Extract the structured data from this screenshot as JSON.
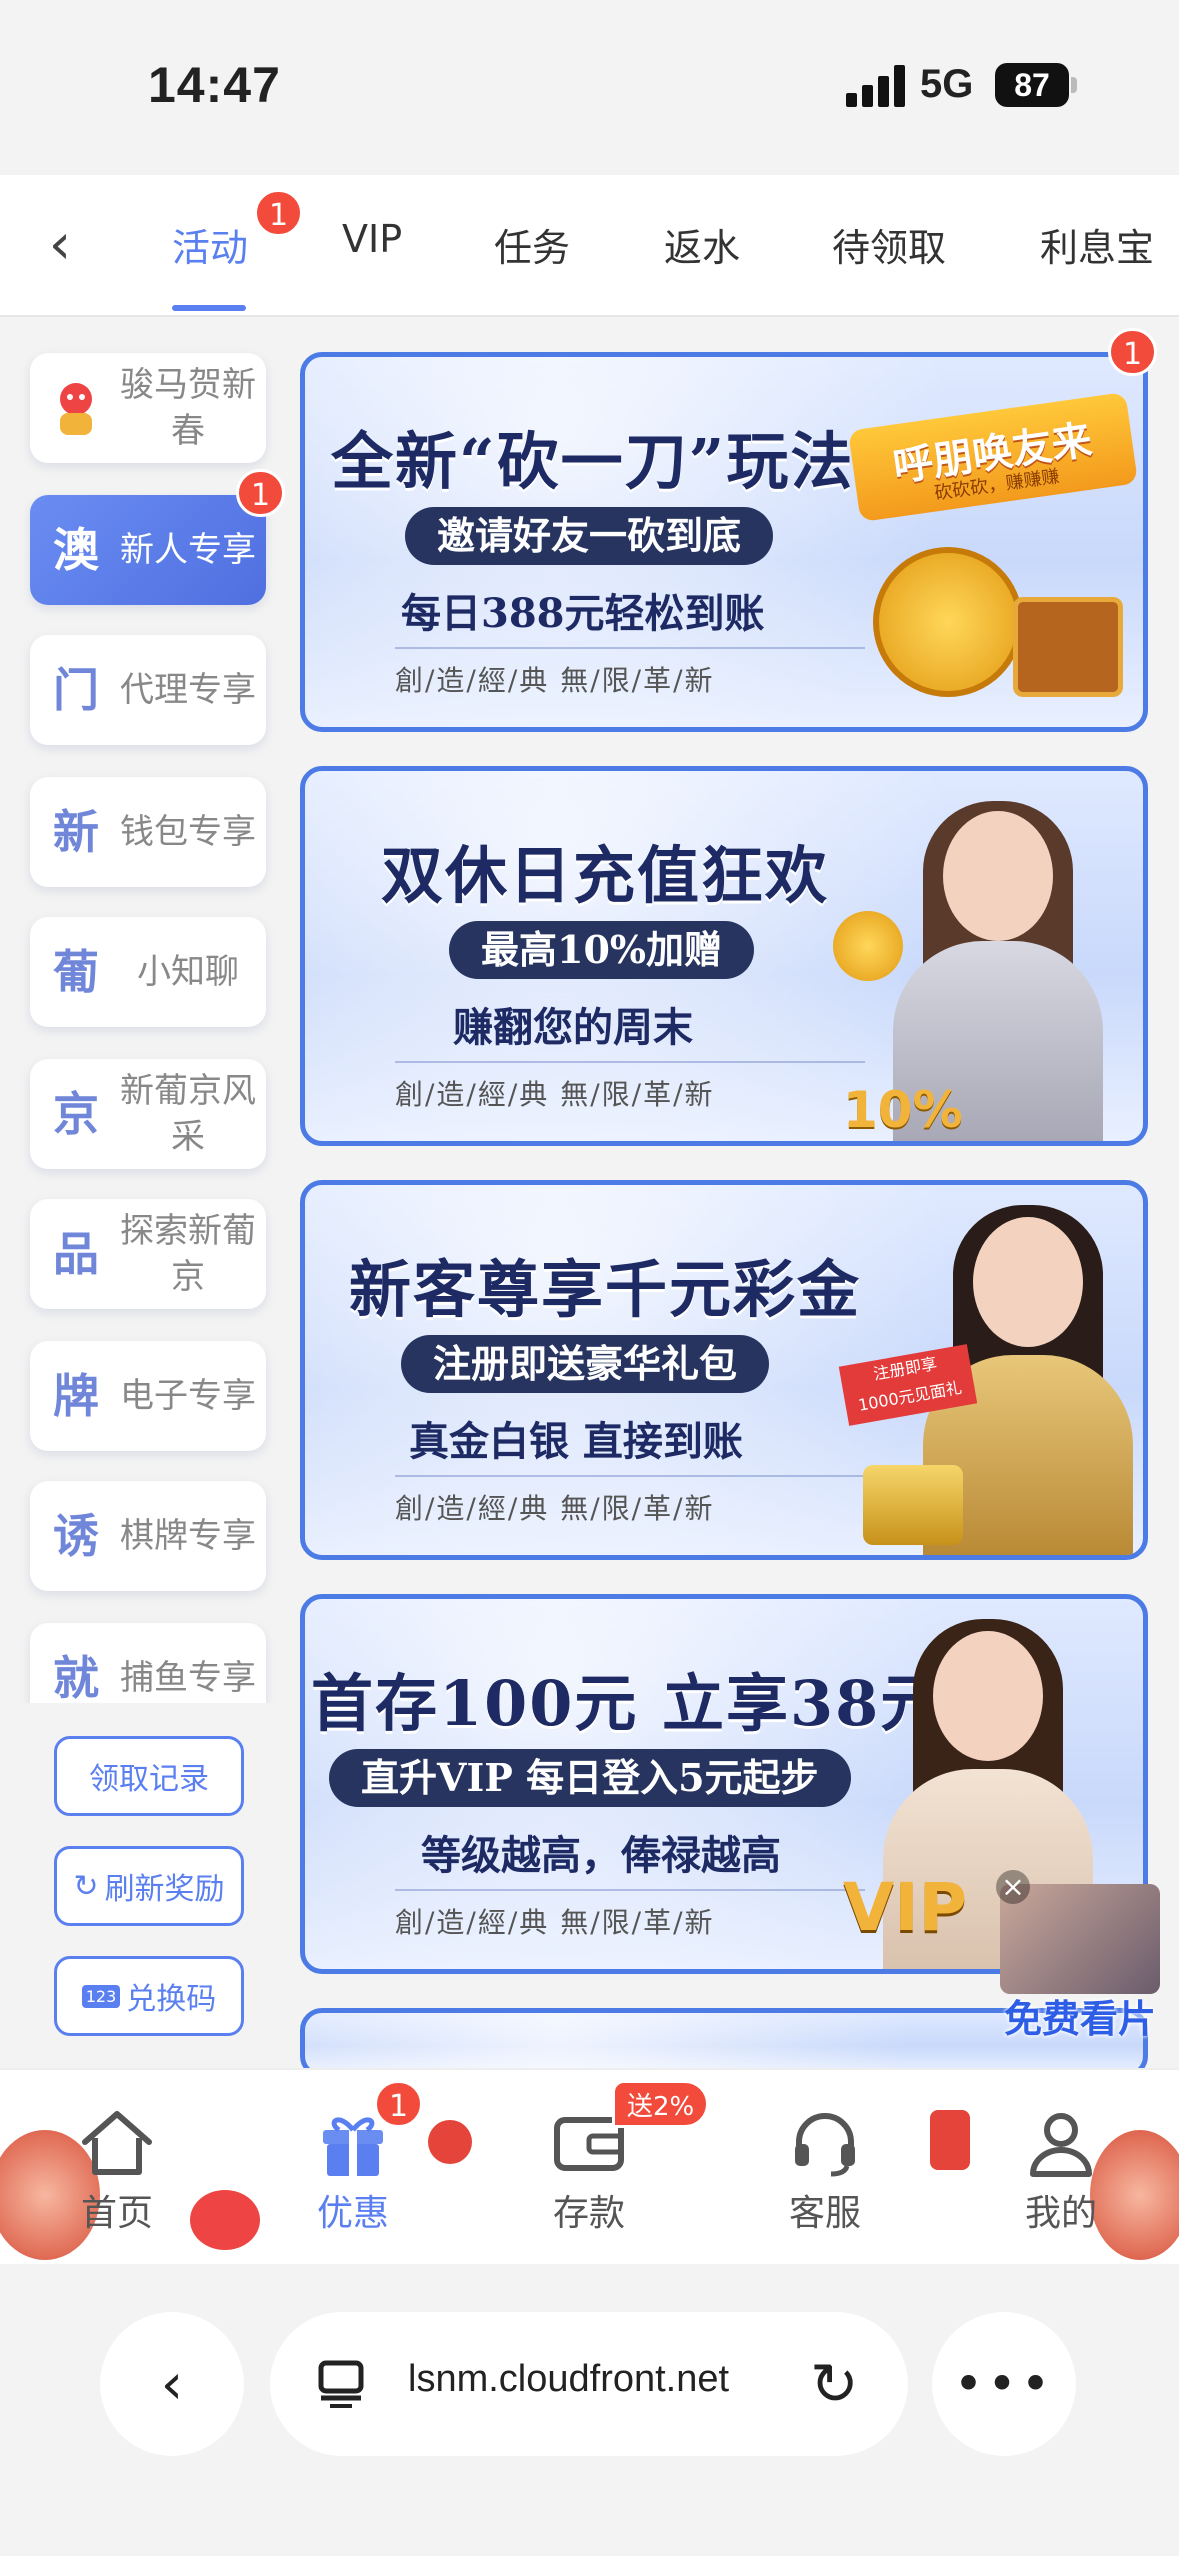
{
  "status_bar": {
    "time": "14:47",
    "network": "5G",
    "battery": "87"
  },
  "tabs": {
    "items": [
      "活动",
      "VIP",
      "任务",
      "返水",
      "待领取",
      "利息宝"
    ],
    "active_badge": "1"
  },
  "sidebar": {
    "items": [
      {
        "glyph": "",
        "label": "骏马贺新春"
      },
      {
        "glyph": "澳",
        "label": "新人专享",
        "badge": "1"
      },
      {
        "glyph": "门",
        "label": "代理专享"
      },
      {
        "glyph": "新",
        "label": "钱包专享"
      },
      {
        "glyph": "葡",
        "label": "小知聊"
      },
      {
        "glyph": "京",
        "label": "新葡京风采"
      },
      {
        "glyph": "品",
        "label": "探索新葡京"
      },
      {
        "glyph": "牌",
        "label": "电子专享"
      },
      {
        "glyph": "诱",
        "label": "棋牌专享"
      },
      {
        "glyph": "就",
        "label": "捕鱼专享"
      }
    ],
    "buttons": {
      "records": "领取记录",
      "refresh": "刷新奖励",
      "redeem": "兑换码",
      "redeem_icon_text": "123"
    }
  },
  "banners": [
    {
      "title": "全新“砍一刀”玩法",
      "pill": "邀请好友一砍到底",
      "sub": "每日388元轻松到账",
      "motto": "創/造/經/典 無/限/革/新",
      "badge": "1",
      "tag": "呼朋唤友来",
      "tag_sub": "砍砍砍，赚赚赚"
    },
    {
      "title": "双休日充值狂欢",
      "pill": "最高10%加赠",
      "sub": "赚翻您的周末",
      "motto": "創/造/經/典 無/限/革/新",
      "art_text": "10%"
    },
    {
      "title": "新客尊享千元彩金",
      "pill": "注册即送豪华礼包",
      "sub": "真金白银  直接到账",
      "motto": "創/造/經/典 無/限/革/新",
      "art_text": "注册即享\n1000元见面礼"
    },
    {
      "title": "首存100元 立享38元",
      "pill": "直升VIP  每日登入5元起步",
      "sub": "等级越高，俸禄越高",
      "motto": "創/造/經/典 無/限/革/新",
      "art_text": "VIP"
    }
  ],
  "float_ad": {
    "label": "免费看片"
  },
  "bottom_nav": {
    "items": [
      {
        "label": "首页",
        "icon": "home-icon"
      },
      {
        "label": "优惠",
        "icon": "gift-icon",
        "badge": "1"
      },
      {
        "label": "存款",
        "icon": "wallet-icon",
        "badge": "送2%"
      },
      {
        "label": "客服",
        "icon": "headset-icon"
      },
      {
        "label": "我的",
        "icon": "user-icon"
      }
    ]
  },
  "browser": {
    "url": "lsnm.cloudfront.net"
  },
  "colors": {
    "accent": "#5a7ff0",
    "badge": "#f24a3b",
    "banner_border": "#4c7be6",
    "title_navy": "#1d2a63"
  }
}
